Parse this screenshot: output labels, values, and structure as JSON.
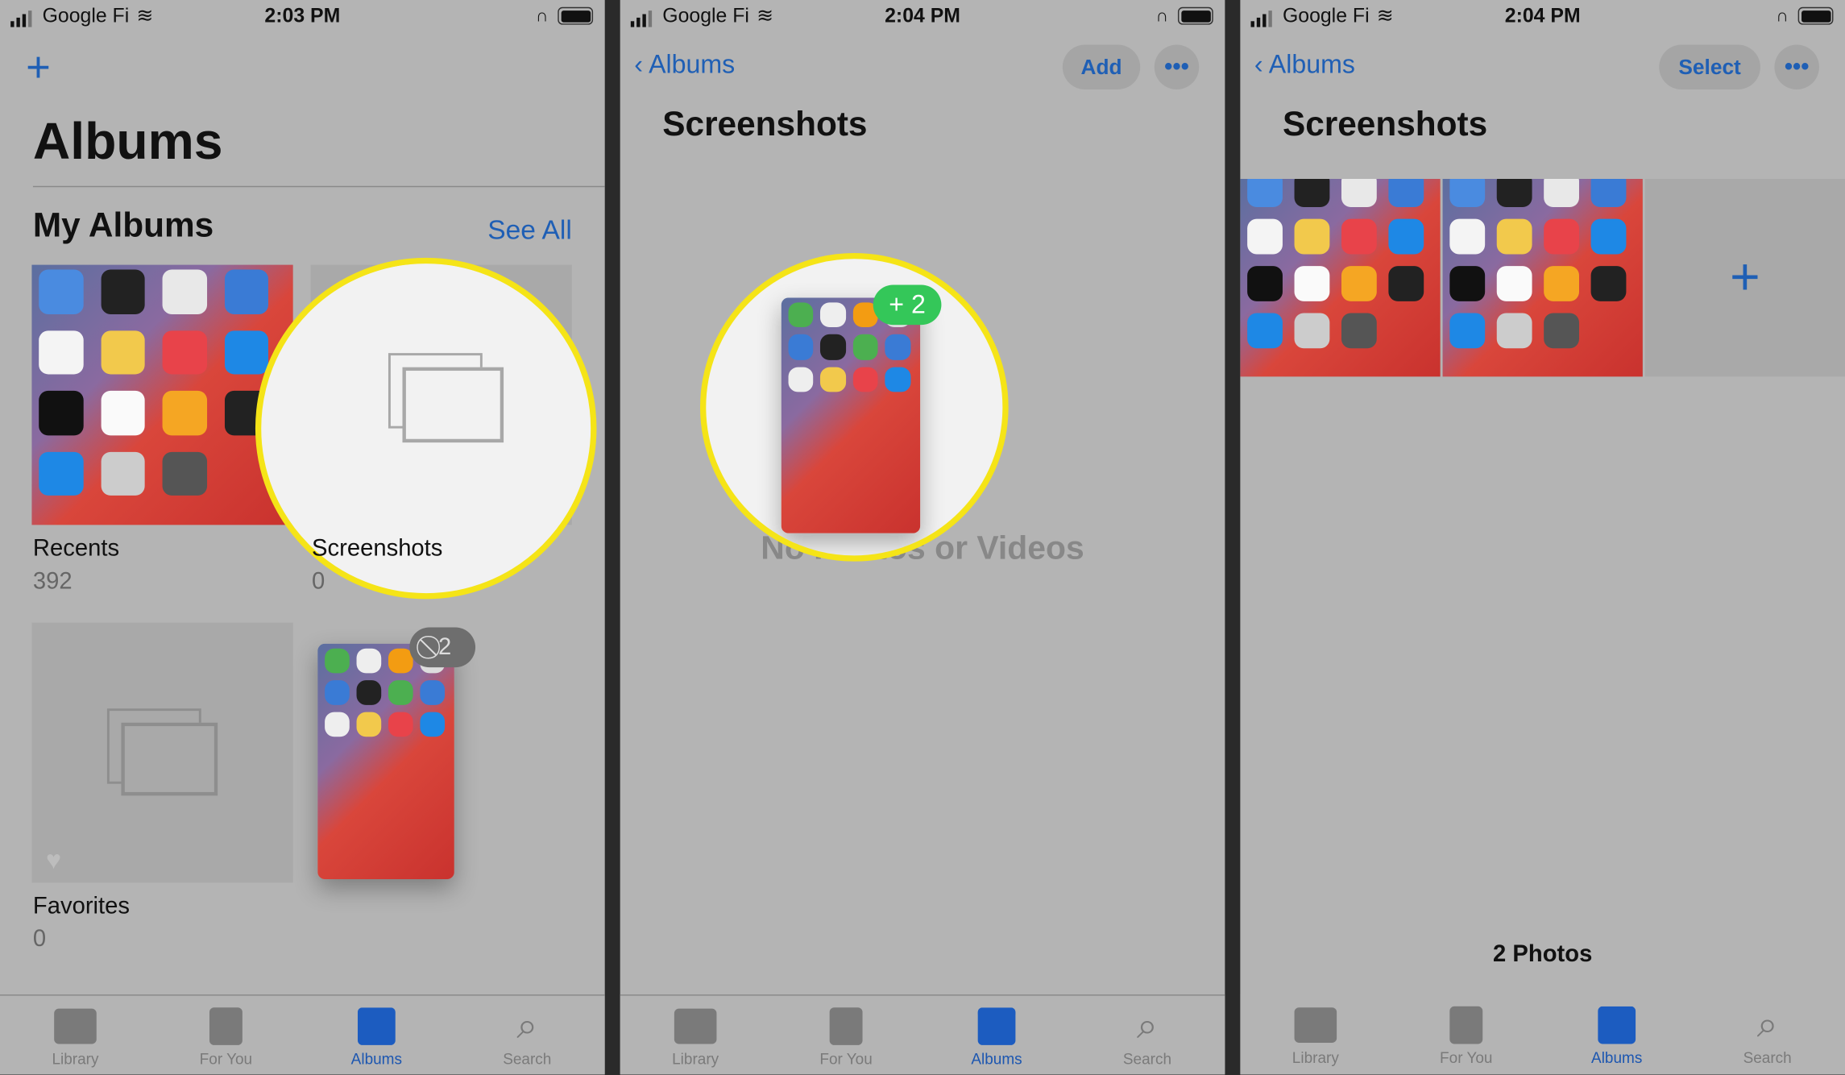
{
  "status_bars": [
    {
      "carrier": "Google Fi",
      "time": "2:03 PM"
    },
    {
      "carrier": "Google Fi",
      "time": "2:04 PM"
    },
    {
      "carrier": "Google Fi",
      "time": "2:04 PM"
    }
  ],
  "panel1": {
    "add_icon": "plus-icon",
    "title": "Albums",
    "section": "My Albums",
    "see_all": "See All",
    "albums": [
      {
        "name": "Recents",
        "count": "392"
      },
      {
        "name": "Screenshots",
        "count": "0"
      },
      {
        "name": "Favorites",
        "count": "0"
      }
    ],
    "drag_badge": "2"
  },
  "panel2": {
    "back": "Albums",
    "add": "Add",
    "title": "Screenshots",
    "empty": "No Photos or Videos",
    "drag_badge": "+ 2"
  },
  "panel3": {
    "back": "Albums",
    "select": "Select",
    "title": "Screenshots",
    "footer": "2 Photos"
  },
  "tabs": [
    "Library",
    "For You",
    "Albums",
    "Search"
  ],
  "colors": {
    "accent": "#1f5fb5",
    "highlight": "#f5e417",
    "badge_green": "#34c759"
  }
}
